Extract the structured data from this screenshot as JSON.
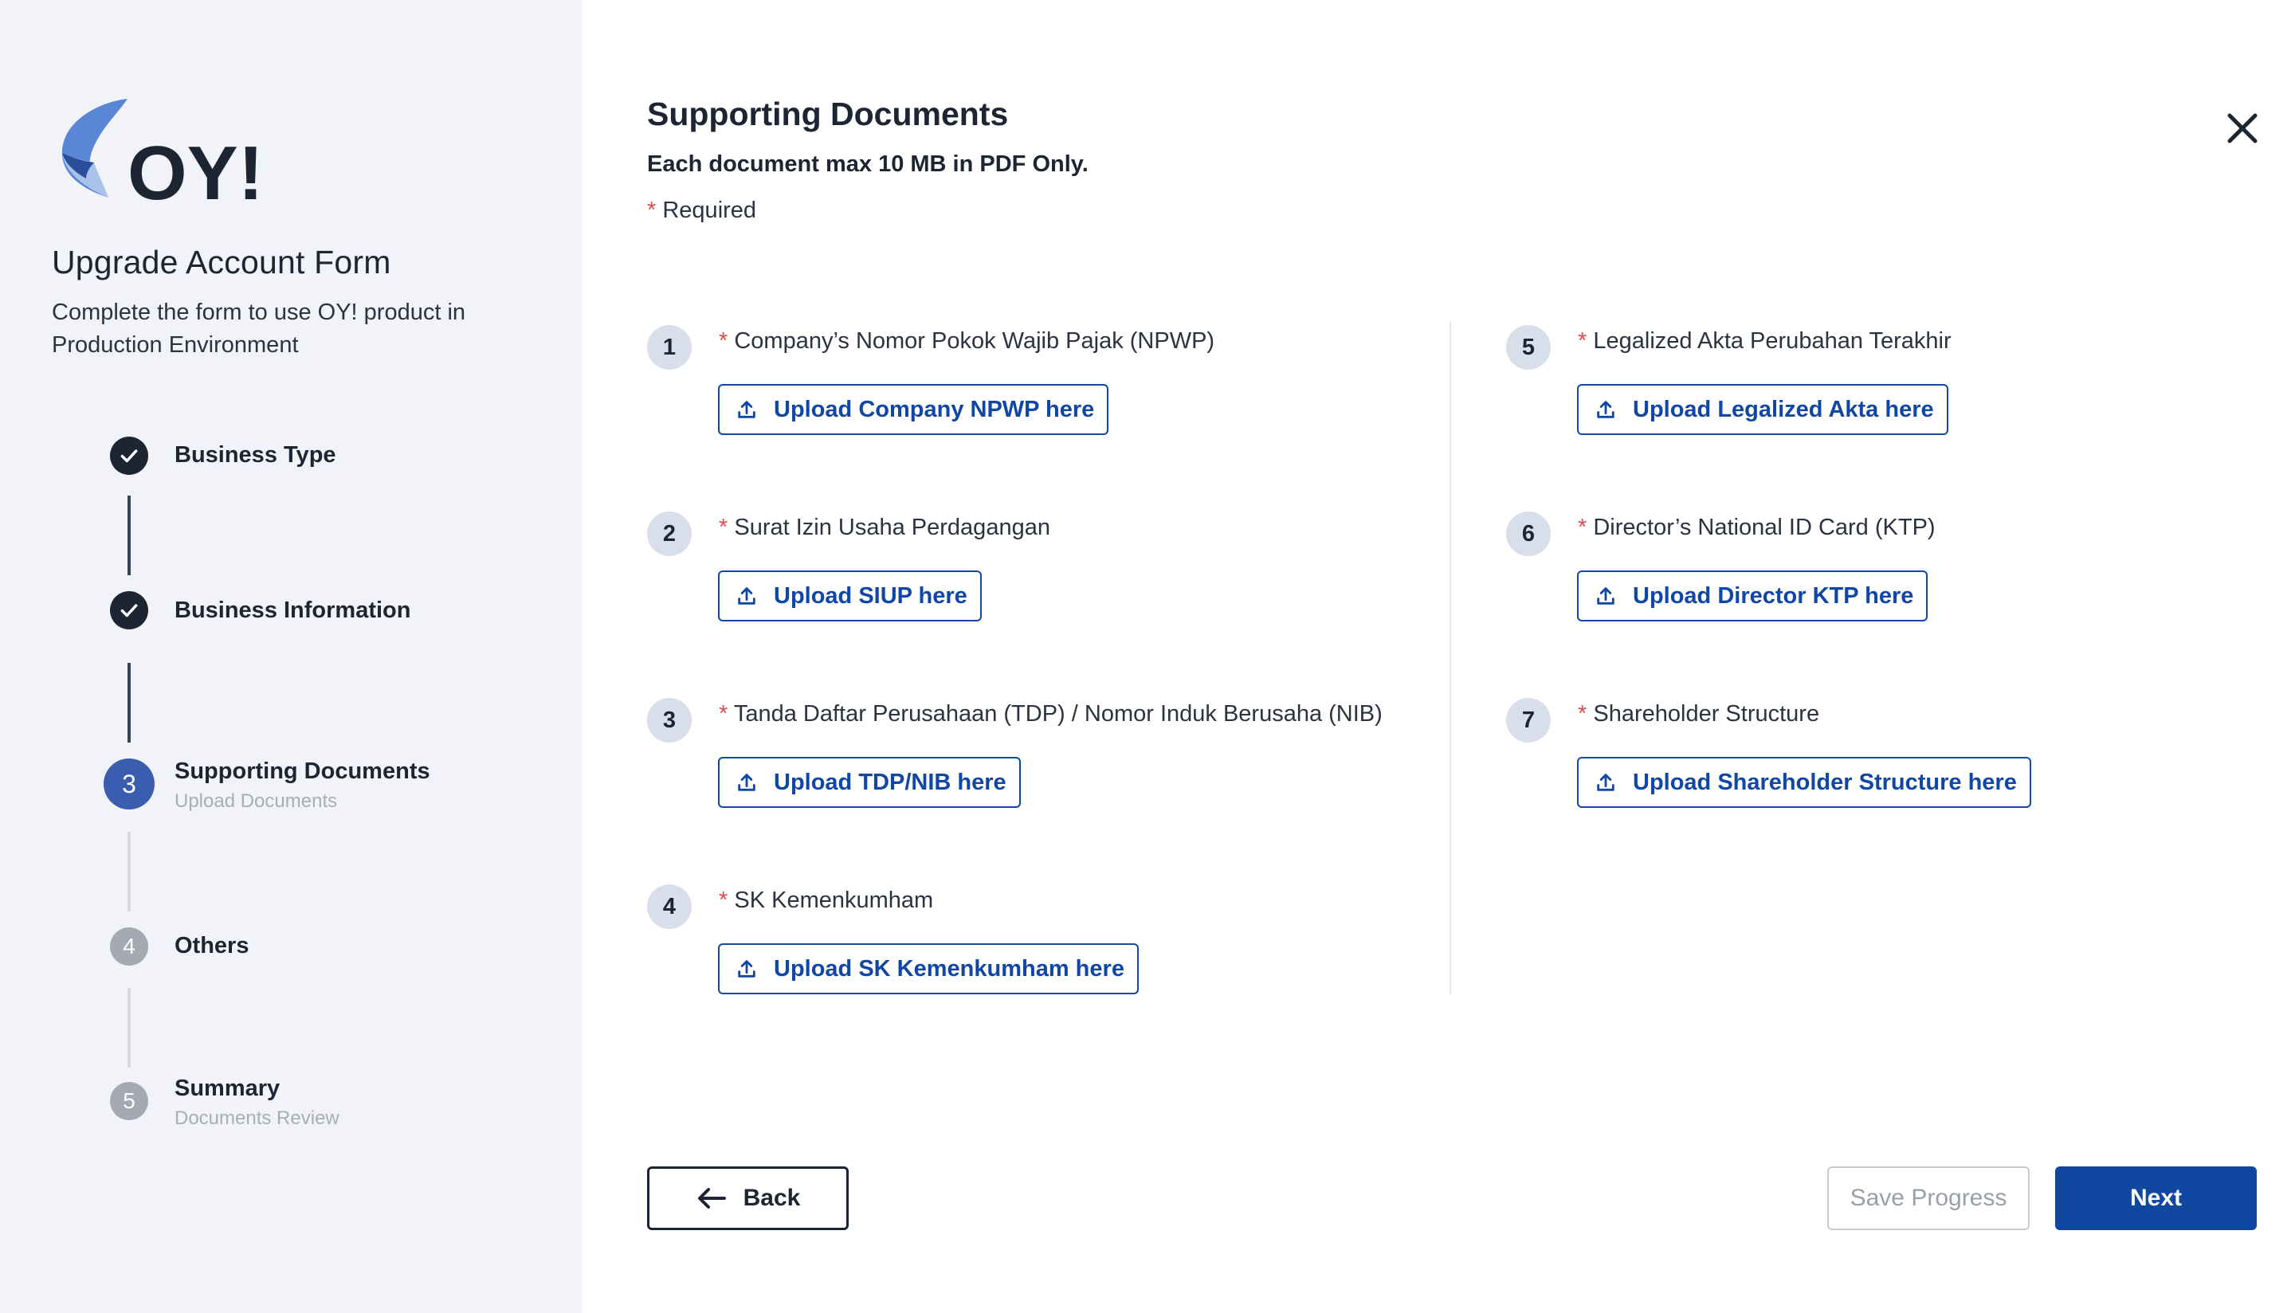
{
  "brand": {
    "logo_text": "OY!"
  },
  "sidebar": {
    "title": "Upgrade Account Form",
    "description": "Complete the form to use OY! product in Production Environment",
    "steps": [
      {
        "number": "1",
        "label": "Business Type",
        "status": "done",
        "sub": ""
      },
      {
        "number": "2",
        "label": "Business Information",
        "status": "done",
        "sub": ""
      },
      {
        "number": "3",
        "label": "Supporting Documents",
        "status": "active",
        "sub": "Upload Documents"
      },
      {
        "number": "4",
        "label": "Others",
        "status": "pending",
        "sub": ""
      },
      {
        "number": "5",
        "label": "Summary",
        "status": "pending",
        "sub": "Documents Review"
      }
    ]
  },
  "main": {
    "title": "Supporting Documents",
    "subtitle": "Each document max 10 MB in PDF Only.",
    "required_mark": "*",
    "required_label": "Required",
    "documents": [
      {
        "number": "1",
        "label": "Company’s Nomor Pokok Wajib Pajak (NPWP)",
        "button": "Upload Company NPWP here",
        "required": true
      },
      {
        "number": "2",
        "label": "Surat Izin Usaha Perdagangan",
        "button": "Upload SIUP here",
        "required": true
      },
      {
        "number": "3",
        "label": "Tanda Daftar Perusahaan (TDP) / Nomor Induk Berusaha (NIB)",
        "button": "Upload TDP/NIB here",
        "required": true
      },
      {
        "number": "4",
        "label": " SK Kemenkumham",
        "button": "Upload SK Kemenkumham here",
        "required": true
      },
      {
        "number": "5",
        "label": "Legalized Akta Perubahan Terakhir",
        "button": "Upload Legalized Akta here",
        "required": true
      },
      {
        "number": "6",
        "label": "Director’s National ID Card (KTP)",
        "button": "Upload Director KTP here",
        "required": true
      },
      {
        "number": "7",
        "label": "Shareholder Structure",
        "button": "Upload Shareholder Structure here",
        "required": true
      }
    ]
  },
  "footer": {
    "back_label": "Back",
    "save_label": "Save Progress",
    "next_label": "Next"
  },
  "colors": {
    "primary": "#0f47a1",
    "sidebar_bg": "#f1f3f8",
    "active_step": "#3a5db0",
    "required": "#e14b4b"
  }
}
